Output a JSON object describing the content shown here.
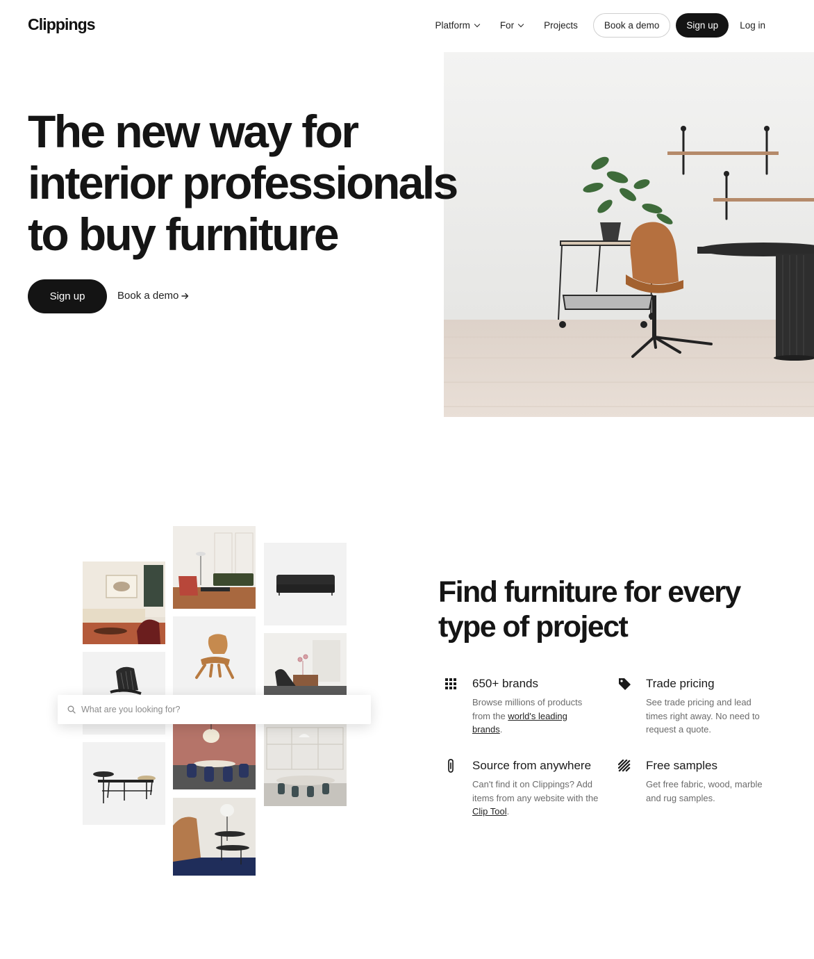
{
  "header": {
    "logo": "Clippings",
    "nav": {
      "platform": "Platform",
      "for": "For",
      "projects": "Projects",
      "book_demo": "Book a demo",
      "sign_up": "Sign up",
      "log_in": "Log in"
    }
  },
  "hero": {
    "title_lines": [
      "The new way for",
      "interior professionals",
      "to buy furniture"
    ],
    "cta_primary": "Sign up",
    "cta_secondary": "Book a demo"
  },
  "search": {
    "placeholder": "What are you looking for?"
  },
  "features_section": {
    "title_lines": [
      "Find furniture for every",
      "type of project"
    ],
    "items": [
      {
        "icon": "grid-icon",
        "title": "650+ brands",
        "body_before": "Browse millions of products from the ",
        "link": "world's leading brands",
        "body_after": "."
      },
      {
        "icon": "tag-icon",
        "title": "Trade pricing",
        "body": "See trade pricing and lead times right away. No need to request a quote."
      },
      {
        "icon": "paperclip-icon",
        "title": "Source from anywhere",
        "body_before": "Can't find it on Clippings? Add items from any website with the ",
        "link": "Clip Tool",
        "body_after": "."
      },
      {
        "icon": "stripes-icon",
        "title": "Free samples",
        "body": "Get free fabric, wood, marble and rug samples."
      }
    ]
  },
  "colors": {
    "primary_dark": "#141414",
    "text_muted": "#6b6b6b",
    "outline": "#cfcfcf"
  }
}
